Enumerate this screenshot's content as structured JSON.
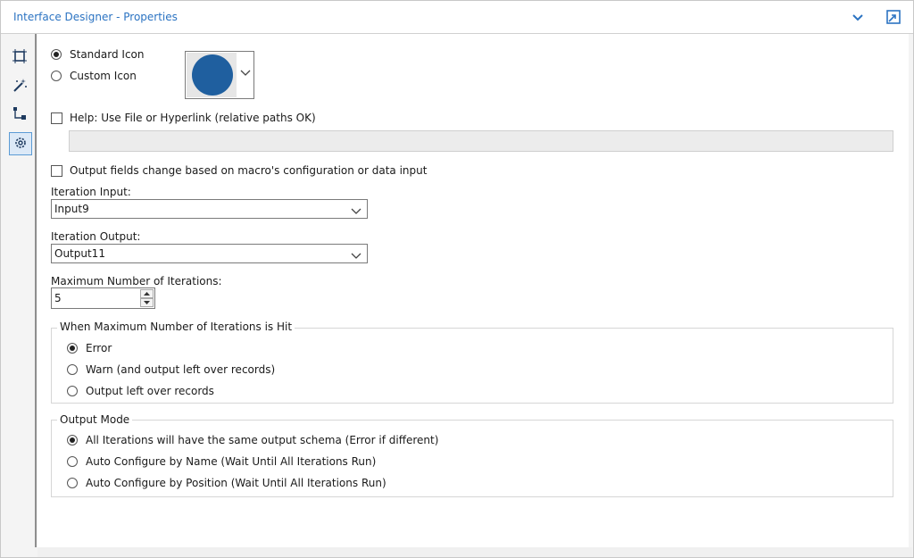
{
  "window": {
    "title": "Interface Designer - Properties",
    "accent_color": "#2b73c2"
  },
  "sidebar": {
    "items": [
      {
        "icon": "layout-icon",
        "label": "Layout"
      },
      {
        "icon": "magic-wand-icon",
        "label": "Actions"
      },
      {
        "icon": "tree-icon",
        "label": "Tree"
      },
      {
        "icon": "gear-icon",
        "label": "Properties",
        "active": true
      }
    ]
  },
  "icon_section": {
    "standard_label": "Standard Icon",
    "custom_label": "Custom Icon",
    "selected": "standard",
    "icon_color": "#1f5f9f"
  },
  "help": {
    "label": "Help: Use File or Hyperlink (relative paths OK)",
    "checked": false,
    "value": ""
  },
  "output_fields": {
    "label": "Output fields change based on macro's configuration or data input",
    "checked": false
  },
  "iteration_input": {
    "label": "Iteration Input:",
    "value": "Input9"
  },
  "iteration_output": {
    "label": "Iteration Output:",
    "value": "Output11"
  },
  "max_iterations": {
    "label": "Maximum Number of Iterations:",
    "value": "5"
  },
  "when_max_hit": {
    "title": "When Maximum Number of Iterations is Hit",
    "options": [
      "Error",
      "Warn (and output left over records)",
      "Output left over records"
    ],
    "selected_index": 0
  },
  "output_mode": {
    "title": "Output Mode",
    "options": [
      "All Iterations will have the same output schema (Error if different)",
      "Auto Configure by Name (Wait Until All Iterations Run)",
      "Auto Configure by Position (Wait Until All Iterations Run)"
    ],
    "selected_index": 0
  }
}
